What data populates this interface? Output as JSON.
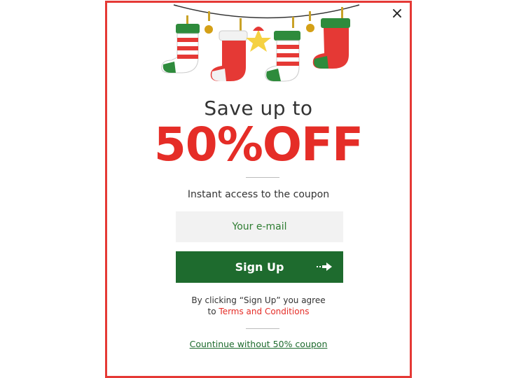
{
  "popup": {
    "close_glyph": "×",
    "headline": "Save up to",
    "discount": "50%OFF",
    "subtitle": "Instant  access to the coupon",
    "email_placeholder": "Your e-mail",
    "signup_label": "Sign Up",
    "disclaimer_prefix": "By clicking “Sign Up” you agree",
    "disclaimer_to": "to ",
    "terms_link": "Terms and Conditions",
    "continue_link": "Countinue without 50% coupon"
  },
  "icons": {
    "close": "close-icon",
    "signup_arrow": "arrow-right-icon",
    "decoration": "christmas-stockings-illustration"
  },
  "colors": {
    "border": "#e53935",
    "accent_red": "#e52d27",
    "button_green": "#1e6b2e",
    "input_bg": "#f2f2f2",
    "input_text": "#2e7d32"
  }
}
